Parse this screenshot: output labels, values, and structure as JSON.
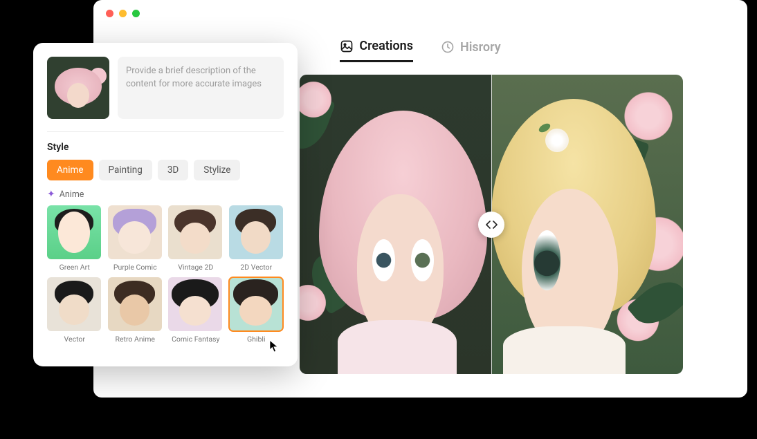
{
  "tabs": {
    "creations": "Creations",
    "history": "Hisrory"
  },
  "panel": {
    "prompt_placeholder": "Provide a brief description of the content for more accurate images",
    "style_label": "Style",
    "categories": [
      {
        "label": "Anime",
        "active": true
      },
      {
        "label": "Painting",
        "active": false
      },
      {
        "label": "3D",
        "active": false
      },
      {
        "label": "Stylize",
        "active": false
      }
    ],
    "substyle_label": "Anime",
    "styles": [
      {
        "name": "Green Art",
        "selected": false
      },
      {
        "name": "Purple Comic",
        "selected": false
      },
      {
        "name": "Vintage 2D",
        "selected": false
      },
      {
        "name": "2D Vector",
        "selected": false
      },
      {
        "name": "Vector",
        "selected": false
      },
      {
        "name": "Retro Anime",
        "selected": false
      },
      {
        "name": "Comic Fantasy",
        "selected": false
      },
      {
        "name": "Ghibli",
        "selected": true
      }
    ]
  },
  "colors": {
    "accent": "#ff8a1f"
  }
}
